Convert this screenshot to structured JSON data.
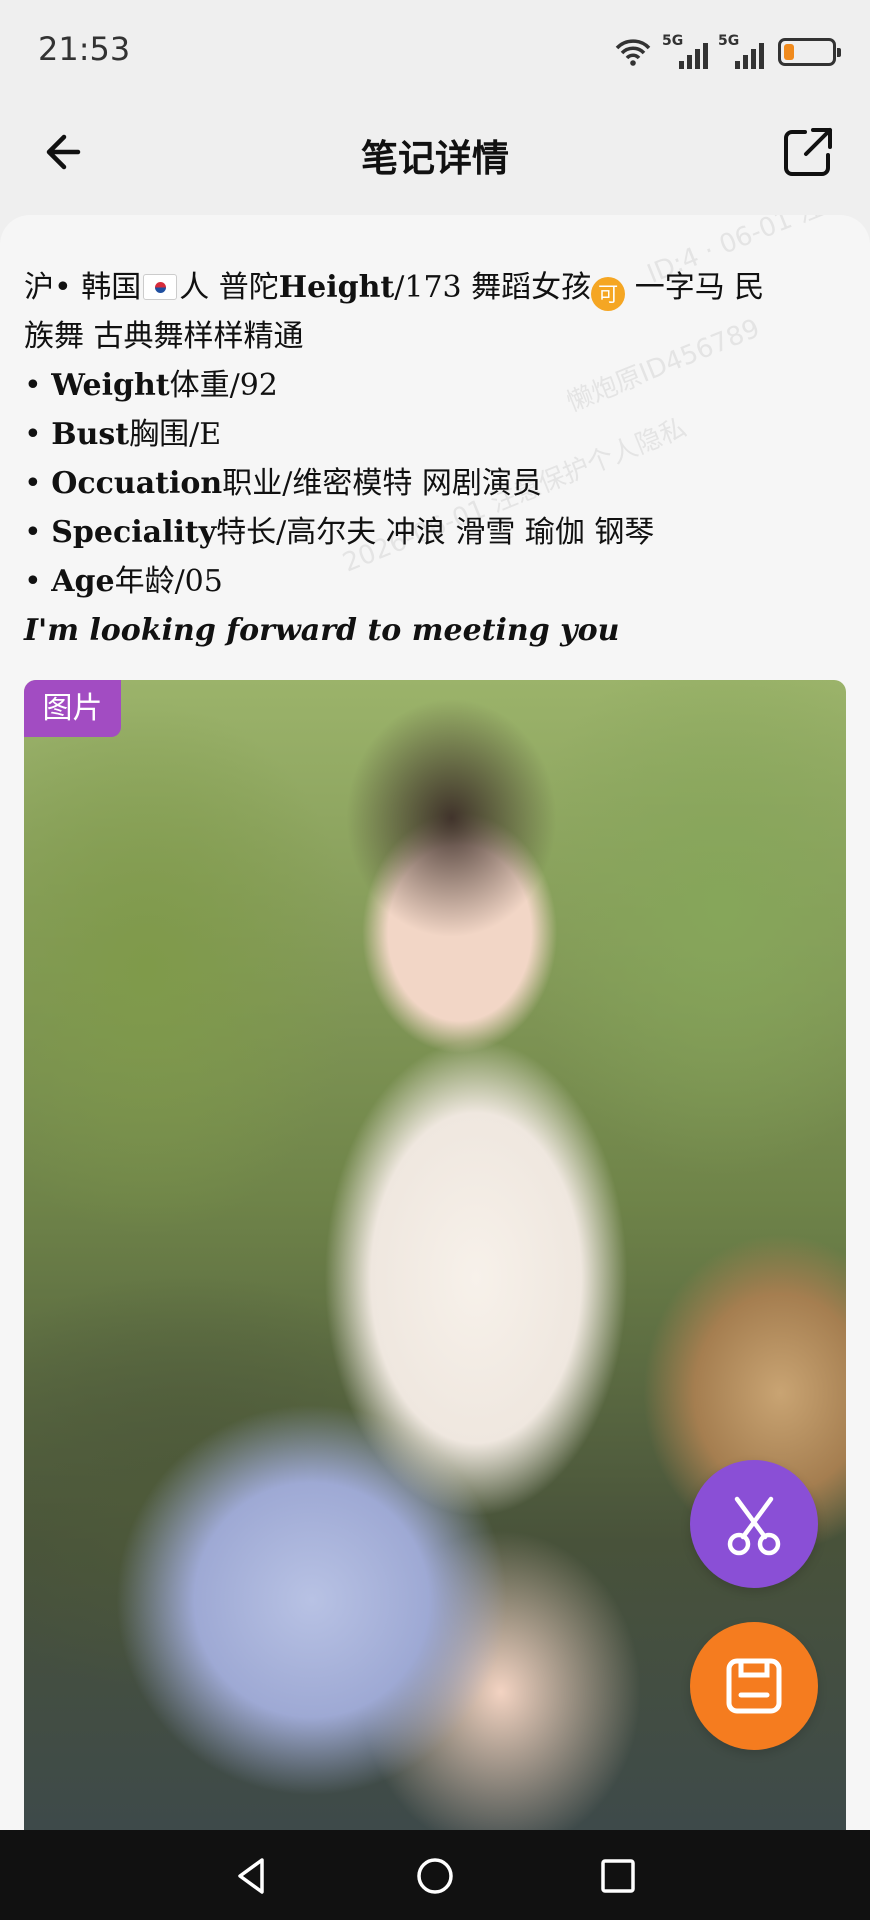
{
  "status_bar": {
    "time": "21:53",
    "signal_1": "5G",
    "signal_2": "5G",
    "icons": [
      "wifi-icon",
      "signal-icon",
      "signal-icon",
      "battery-icon"
    ],
    "battery_color": "#f08a1c"
  },
  "nav": {
    "title": "笔记详情",
    "back_icon": "back-arrow-icon",
    "share_icon": "share-icon"
  },
  "note": {
    "line1_a": "沪• 韩国",
    "line1_b": "人  普陀",
    "line1_height_label": "Height",
    "line1_c": "/173 舞蹈女孩",
    "badge": "可",
    "line1_d": " 一字马 民",
    "line2": "族舞 古典舞样样精通",
    "weight_label": "Weight",
    "weight_value": "体重/92",
    "bust_label": "Bust",
    "bust_value": "胸围/E",
    "occupation_label": "Occuation",
    "occupation_value": "职业/维密模特 网剧演员",
    "speciality_label": "Speciality",
    "speciality_value": "特长/高尔夫 冲浪 滑雪 瑜伽 钢琴",
    "age_label": "Age",
    "age_value": "年龄/05",
    "bullet": "• ",
    "closing": "I'm looking forward to meeting you"
  },
  "photo": {
    "tag": "图片"
  },
  "fabs": {
    "cut_icon": "scissors-icon",
    "save_icon": "save-icon",
    "cut_color": "#8a4fd6",
    "save_color": "#f57c1f"
  },
  "system_nav": {
    "icons": [
      "back-triangle-icon",
      "home-circle-icon",
      "recents-square-icon"
    ]
  }
}
